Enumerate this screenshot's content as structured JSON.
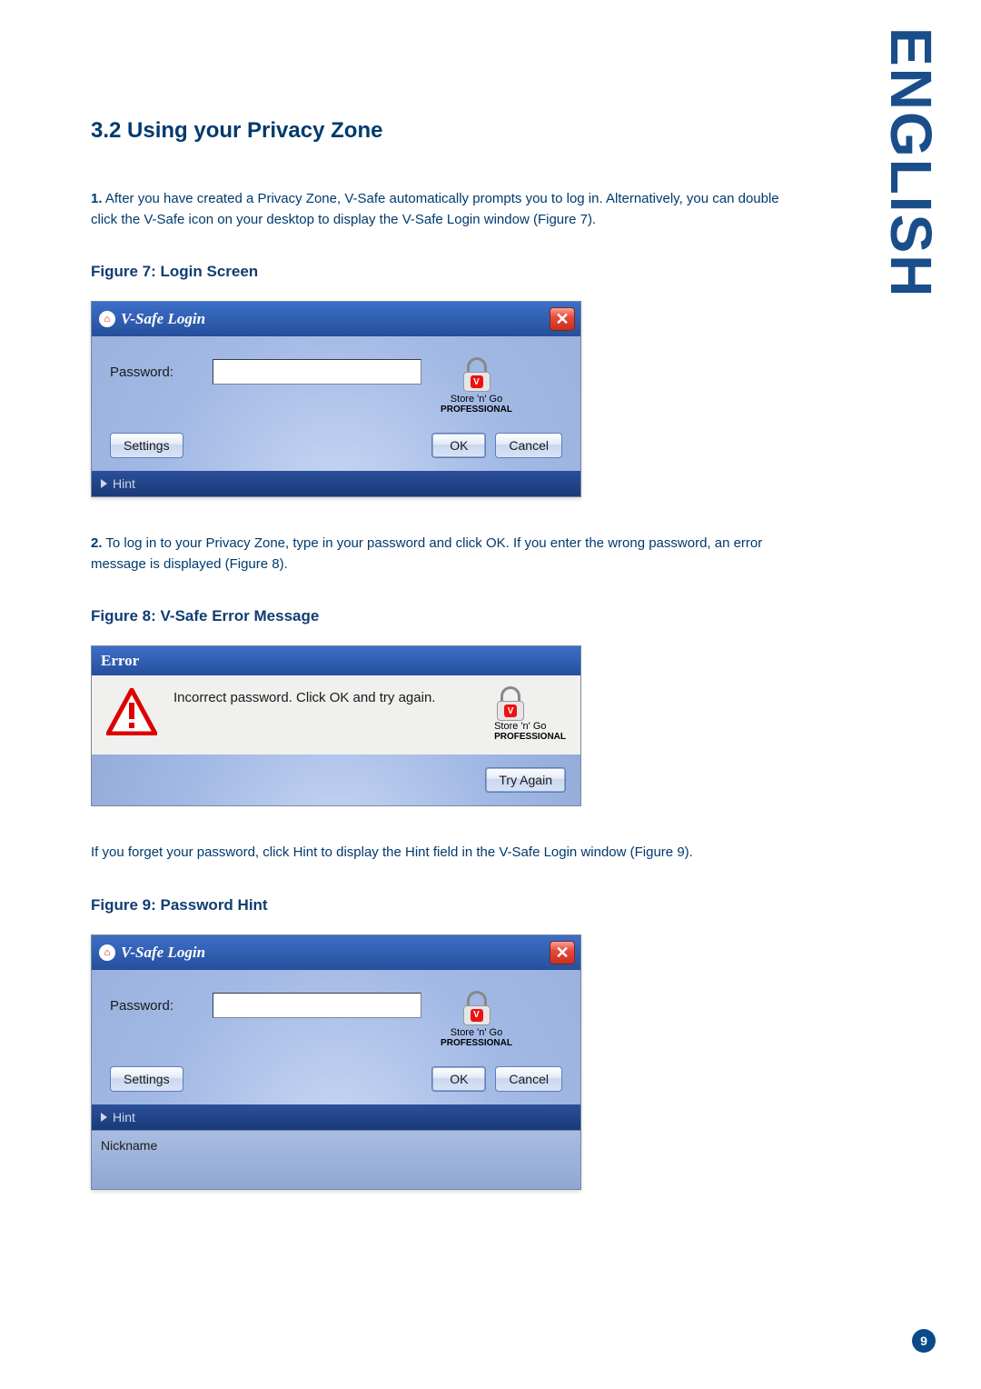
{
  "sideLabel": "ENGLISH",
  "sectionTitle": "3.2 Using your Privacy Zone",
  "step1": {
    "num": "1.",
    "text": "After you have created a Privacy Zone, V-Safe automatically prompts you to log in. Alternatively, you can double click the V-Safe icon on your desktop to display the V-Safe Login window (Figure 7)."
  },
  "fig7": {
    "caption": "Figure 7: Login Screen",
    "title": "V-Safe Login",
    "passwordLabel": "Password:",
    "brandLine1": "Store 'n' Go",
    "brandLine2": "PROFESSIONAL",
    "settings": "Settings",
    "ok": "OK",
    "cancel": "Cancel",
    "hint": "Hint"
  },
  "step2": {
    "num": "2.",
    "text": "To log in to your Privacy Zone, type in your password and click OK. If you enter the wrong password, an error message is displayed (Figure 8)."
  },
  "fig8": {
    "caption": "Figure 8: V-Safe Error Message",
    "title": "Error",
    "message": "Incorrect password. Click OK and try again.",
    "brandLine1": "Store 'n' Go",
    "brandLine2": "PROFESSIONAL",
    "tryAgain": "Try Again"
  },
  "afterFig8": "If you forget your password, click Hint to display the Hint field in the V-Safe Login window (Figure 9).",
  "fig9": {
    "caption": "Figure 9: Password Hint",
    "title": "V-Safe Login",
    "passwordLabel": "Password:",
    "brandLine1": "Store 'n' Go",
    "brandLine2": "PROFESSIONAL",
    "settings": "Settings",
    "ok": "OK",
    "cancel": "Cancel",
    "hint": "Hint",
    "nickname": "Nickname"
  },
  "pageNumber": "9"
}
